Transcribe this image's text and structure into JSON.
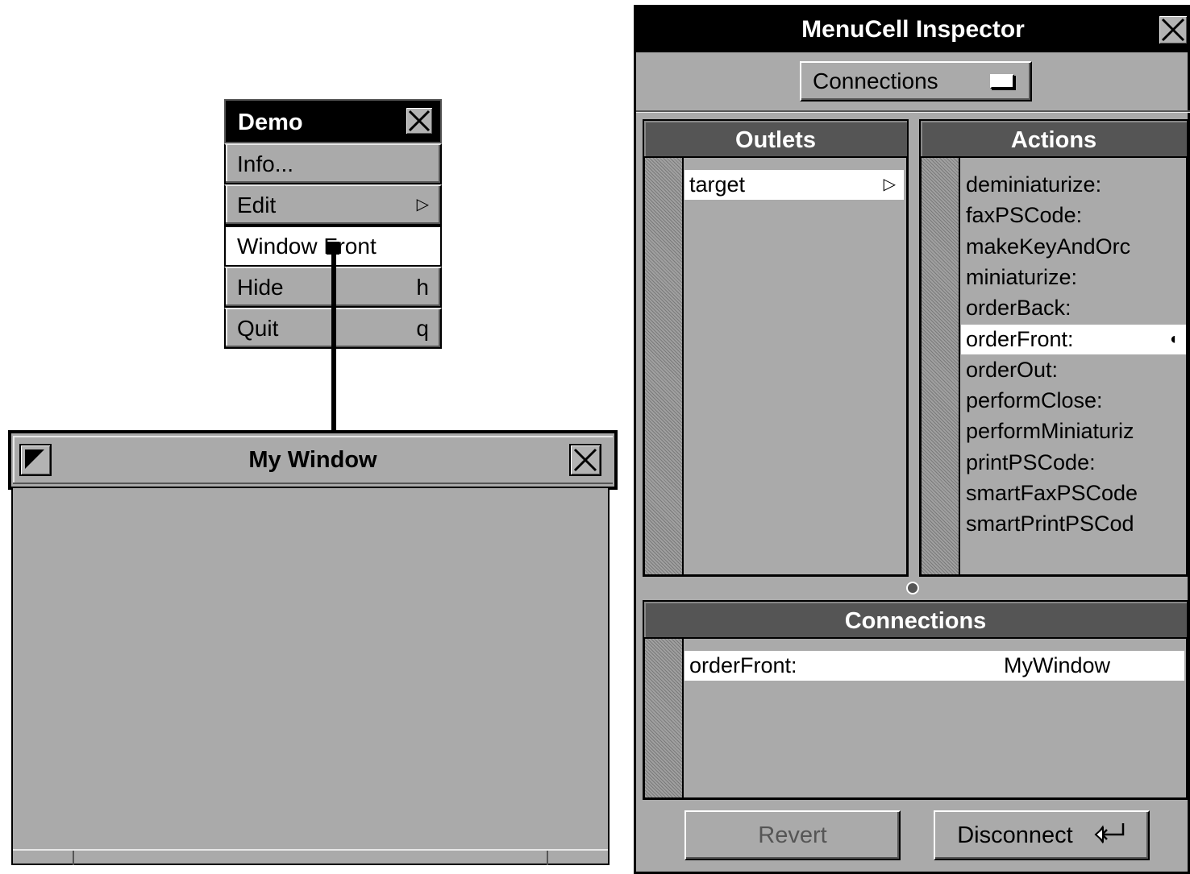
{
  "demo_menu": {
    "title": "Demo",
    "items": [
      {
        "label": "Info...",
        "key": ""
      },
      {
        "label": "Edit",
        "key": "▷"
      },
      {
        "label": "Window Front",
        "key": ""
      },
      {
        "label": "Hide",
        "key": "h"
      },
      {
        "label": "Quit",
        "key": "q"
      }
    ]
  },
  "my_window": {
    "title": "My Window"
  },
  "inspector": {
    "title": "MenuCell Inspector",
    "popup_value": "Connections",
    "outlets_header": "Outlets",
    "actions_header": "Actions",
    "outlets": [
      {
        "label": "target",
        "marker": "▷"
      }
    ],
    "actions": [
      "deminiaturize:",
      "faxPSCode:",
      "makeKeyAndOrc",
      "miniaturize:",
      "orderBack:",
      "orderFront:",
      "orderOut:",
      "performClose:",
      "performMiniaturiz",
      "printPSCode:",
      "smartFaxPSCode",
      "smartPrintPSCod"
    ],
    "selected_action_marker": "◖",
    "connections_header": "Connections",
    "connections": [
      {
        "action": "orderFront:",
        "target": "MyWindow"
      }
    ],
    "revert_label": "Revert",
    "disconnect_label": "Disconnect",
    "disconnect_icon": "return-key-icon"
  },
  "colors": {
    "panel_gray": "#aaaaaa",
    "header_dark": "#555555",
    "title_black": "#000000",
    "highlight": "#ffffff"
  }
}
